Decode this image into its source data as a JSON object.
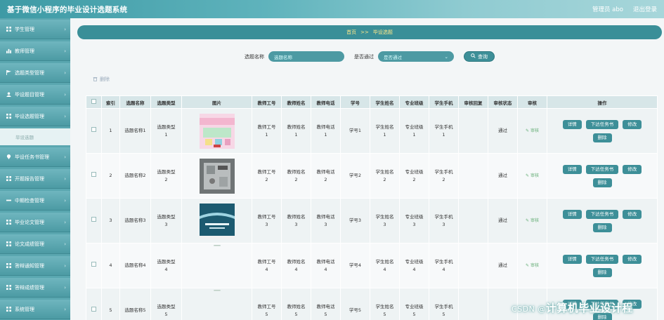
{
  "header": {
    "title": "基于微信小程序的毕业设计选题系统",
    "user": "管理员 abo",
    "logout": "退出登录"
  },
  "sidebar": {
    "items": [
      {
        "label": "学生管理",
        "icon": "grid-icon"
      },
      {
        "label": "教师管理",
        "icon": "chart-icon"
      },
      {
        "label": "选题类型管理",
        "icon": "flag-icon"
      },
      {
        "label": "毕设题目管理",
        "icon": "user-icon"
      },
      {
        "label": "毕设选题管理",
        "icon": "grid-icon"
      },
      {
        "label": "毕设选题",
        "sub": true
      },
      {
        "label": "毕设任务书管理",
        "icon": "pin-icon"
      },
      {
        "label": "开题报告管理",
        "icon": "grid-icon"
      },
      {
        "label": "中期检查管理",
        "icon": "minus-icon"
      },
      {
        "label": "毕业论文管理",
        "icon": "grid-icon"
      },
      {
        "label": "论文成绩管理",
        "icon": "grid-icon"
      },
      {
        "label": "答辩通知管理",
        "icon": "grid-icon"
      },
      {
        "label": "答辩成绩管理",
        "icon": "grid-icon"
      },
      {
        "label": "系统管理",
        "icon": "grid-icon"
      }
    ]
  },
  "breadcrumb": {
    "home": "首页",
    "sep": ">>",
    "current": "毕设选题"
  },
  "search": {
    "name_label": "选题名称",
    "name_placeholder": "选题名称",
    "pass_label": "是否通过",
    "pass_value": "是否通过",
    "button": "查询"
  },
  "toolbar": {
    "delete": "删除"
  },
  "table": {
    "headers": [
      "索引",
      "选题名称",
      "选题类型",
      "图片",
      "教师工号",
      "教师姓名",
      "教师电话",
      "学号",
      "学生姓名",
      "专业班级",
      "学生手机",
      "审核回复",
      "审核状态",
      "审核",
      "操作"
    ],
    "rows": [
      {
        "idx": "1",
        "name": "选题名称1",
        "type": "选题类型\n1",
        "tno": "教师工号\n1",
        "tname": "教师姓名\n1",
        "tphone": "教师电话\n1",
        "sno": "学号1",
        "sname": "学生姓名\n1",
        "cls": "专业班级\n1",
        "sphone": "学生手机\n1",
        "reply": "",
        "status": "通过",
        "audit": "审核",
        "img": "poster"
      },
      {
        "idx": "2",
        "name": "选题名称2",
        "type": "选题类型\n2",
        "tno": "教师工号\n2",
        "tname": "教师姓名\n2",
        "tphone": "教师电话\n2",
        "sno": "学号2",
        "sname": "学生姓名\n2",
        "cls": "专业班级\n2",
        "sphone": "学生手机\n2",
        "reply": "",
        "status": "通过",
        "audit": "审核",
        "img": "panel"
      },
      {
        "idx": "3",
        "name": "选题名称3",
        "type": "选题类型\n3",
        "tno": "教师工号\n3",
        "tname": "教师姓名\n3",
        "tphone": "教师电话\n3",
        "sno": "学号3",
        "sname": "学生姓名\n3",
        "cls": "专业班级\n3",
        "sphone": "学生手机\n3",
        "reply": "",
        "status": "通过",
        "audit": "审核",
        "img": "book"
      },
      {
        "idx": "4",
        "name": "选题名称4",
        "type": "选题类型\n4",
        "tno": "教师工号\n4",
        "tname": "教师姓名\n4",
        "tphone": "教师电话\n4",
        "sno": "学号4",
        "sname": "学生姓名\n4",
        "cls": "专业班级\n4",
        "sphone": "学生手机\n4",
        "reply": "",
        "status": "通过",
        "audit": "审核",
        "img": "strip"
      },
      {
        "idx": "5",
        "name": "选题名称5",
        "type": "选题类型\n5",
        "tno": "教师工号\n5",
        "tname": "教师姓名\n5",
        "tphone": "教师电话\n5",
        "sno": "学号5",
        "sname": "学生姓名\n5",
        "cls": "专业班级\n5",
        "sphone": "学生手机\n5",
        "reply": "",
        "status": "",
        "audit": "",
        "img": "strip"
      }
    ],
    "ops": [
      "详情",
      "下达任务书",
      "修改",
      "删除"
    ]
  },
  "watermark": {
    "prefix": "CSDN @",
    "text": "计算机毕业设计程"
  }
}
